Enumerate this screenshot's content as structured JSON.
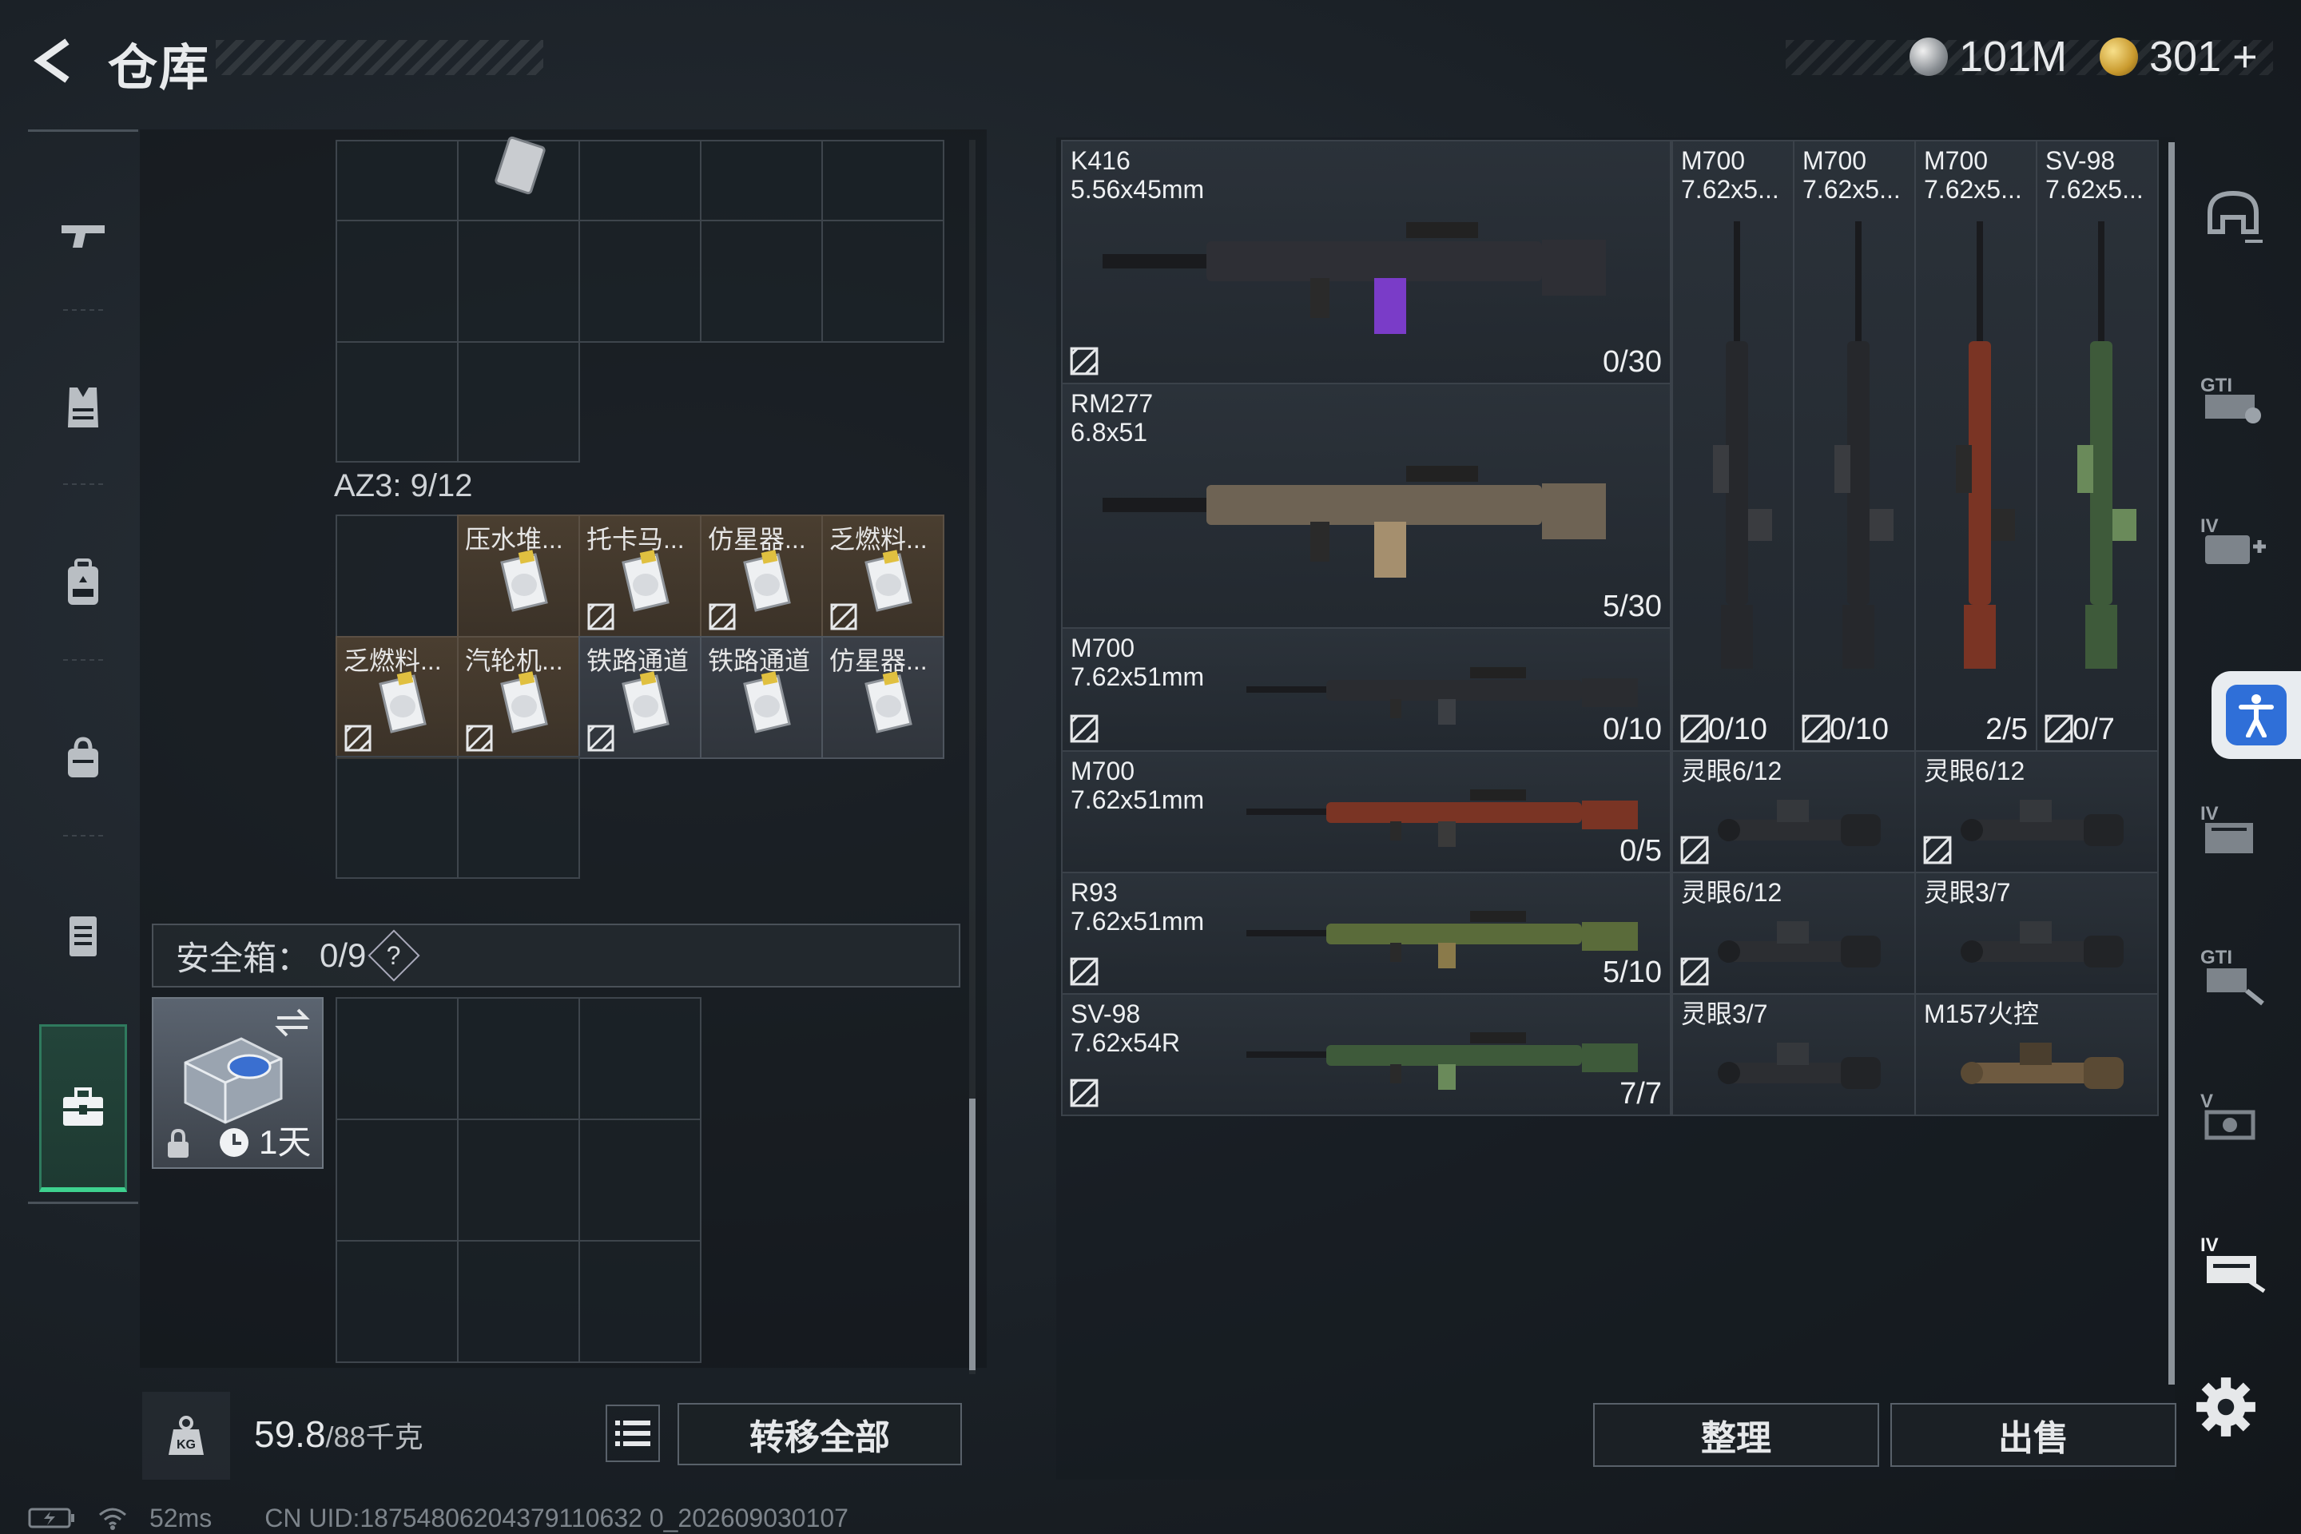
{
  "header": {
    "title": "仓库"
  },
  "currencies": [
    {
      "icon": "silver-coin-icon",
      "value": "101M"
    },
    {
      "icon": "gold-coin-icon",
      "value": "301",
      "plus": "+"
    }
  ],
  "left_nav": [
    {
      "icon": "pistol-icon"
    },
    {
      "icon": "vest-icon"
    },
    {
      "icon": "backpack-icon"
    },
    {
      "icon": "bag-icon"
    },
    {
      "icon": "case-icon"
    },
    {
      "icon": "toolbox-icon",
      "active": true
    }
  ],
  "container": {
    "label": "AZ3: 9/12",
    "items": [
      {
        "label": "压水堆...",
        "bound": false
      },
      {
        "label": "托卡马...",
        "bound": true
      },
      {
        "label": "仿星器...",
        "bound": true
      },
      {
        "label": "乏燃料...",
        "bound": true
      },
      {
        "label": "乏燃料...",
        "bound": true
      },
      {
        "label": "汽轮机...",
        "bound": true
      },
      {
        "label": "铁路通道",
        "bound": true
      },
      {
        "label": "铁路通道",
        "bound": false
      },
      {
        "label": "仿星器...",
        "bound": false
      }
    ]
  },
  "safe_box": {
    "label": "安全箱：",
    "count": "0/9",
    "help": "?",
    "timer": "1天"
  },
  "footer_left": {
    "weight": "59.8",
    "weight_max": "/88千克",
    "transfer_all": "转移全部"
  },
  "warehouse": {
    "weapons": [
      {
        "name": "K416",
        "caliber": "5.56x45mm",
        "ammo": "0/30"
      },
      {
        "name": "RM277",
        "caliber": "6.8x51",
        "ammo": "5/30"
      },
      {
        "name": "M700",
        "caliber": "7.62x51mm",
        "ammo": "0/10"
      },
      {
        "name": "M700",
        "caliber": "7.62x51mm",
        "ammo": "0/5"
      },
      {
        "name": "R93",
        "caliber": "7.62x51mm",
        "ammo": "5/10"
      },
      {
        "name": "SV-98",
        "caliber": "7.62x54R",
        "ammo": "7/7"
      }
    ],
    "vertical_weapons": [
      {
        "name": "M700",
        "caliber": "7.62x5...",
        "ammo": "0/10"
      },
      {
        "name": "M700",
        "caliber": "7.62x5...",
        "ammo": "0/10"
      },
      {
        "name": "M700",
        "caliber": "7.62x5...",
        "ammo": "2/5"
      },
      {
        "name": "SV-98",
        "caliber": "7.62x5...",
        "ammo": "0/7"
      }
    ],
    "scopes": [
      {
        "name": "灵眼6/12"
      },
      {
        "name": "灵眼6/12"
      },
      {
        "name": "灵眼6/12"
      },
      {
        "name": "灵眼3/7"
      },
      {
        "name": "灵眼3/7"
      },
      {
        "name": "M157火控"
      }
    ]
  },
  "footer_right": {
    "sort": "整理",
    "sell": "出售"
  },
  "status": {
    "ping": "52ms",
    "uid": "CN UID:18754806204379110632 0_202609030107"
  },
  "colors": {
    "accent_green": "#3ed18f",
    "accessibility_blue": "#2f6fd8"
  }
}
